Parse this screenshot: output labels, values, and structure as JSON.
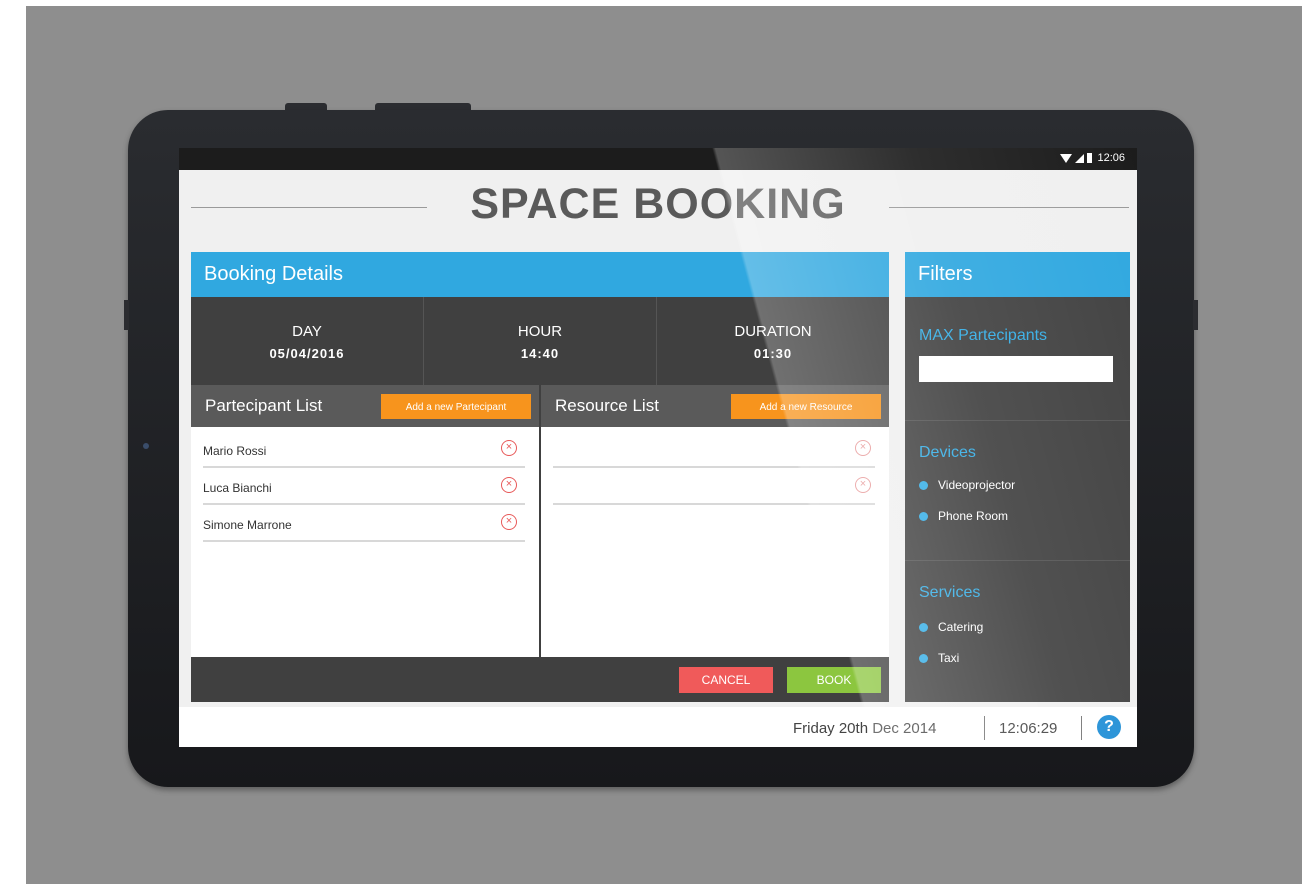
{
  "statusbar": {
    "time": "12:06"
  },
  "app": {
    "title": "SPACE BOOKING"
  },
  "booking": {
    "header": "Booking Details",
    "summary": [
      {
        "label": "DAY",
        "value": "05/04/2016"
      },
      {
        "label": "HOUR",
        "value": "14:40"
      },
      {
        "label": "DURATION",
        "value": "01:30"
      }
    ],
    "participants": {
      "title": "Partecipant List",
      "add_label": "Add a new Partecipant",
      "items": [
        "Mario Rossi",
        "Luca Bianchi",
        "Simone Marrone"
      ]
    },
    "resources": {
      "title": "Resource List",
      "add_label": "Add a new Resource",
      "items": [
        "",
        ""
      ]
    },
    "cancel_label": "CANCEL",
    "book_label": "BOOK"
  },
  "filters": {
    "header": "Filters",
    "max_participants": {
      "label": "MAX Partecipants",
      "value": ""
    },
    "devices": {
      "label": "Devices",
      "items": [
        "Videoprojector",
        "Phone Room"
      ]
    },
    "services": {
      "label": "Services",
      "items": [
        "Catering",
        "Taxi"
      ]
    }
  },
  "footer": {
    "date": "Friday 20th Dec 2014",
    "time": "12:06:29",
    "help": "?"
  },
  "colors": {
    "accent_blue": "#30a8e0",
    "orange": "#f7941d",
    "cancel_red": "#f05a5a",
    "book_green": "#8cc63f",
    "dark_panel": "#404040"
  }
}
